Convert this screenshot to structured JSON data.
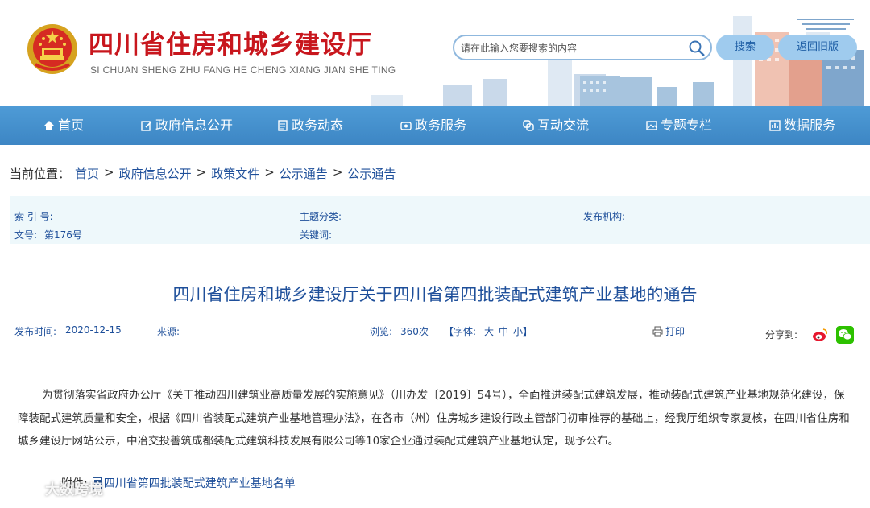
{
  "header": {
    "site_title": "四川省住房和城乡建设厅",
    "site_pinyin": "SI CHUAN SHENG ZHU FANG HE CHENG XIANG JIAN SHE TING",
    "search_placeholder": "请在此输入您要搜索的内容",
    "search_button": "搜索",
    "old_version_button": "返回旧版"
  },
  "nav": {
    "items": [
      {
        "label": "首页",
        "icon": "home-icon"
      },
      {
        "label": "政府信息公开",
        "icon": "edit-icon"
      },
      {
        "label": "政务动态",
        "icon": "document-icon"
      },
      {
        "label": "政务服务",
        "icon": "service-icon"
      },
      {
        "label": "互动交流",
        "icon": "interact-icon"
      },
      {
        "label": "专题专栏",
        "icon": "image-icon"
      },
      {
        "label": "数据服务",
        "icon": "data-icon"
      }
    ]
  },
  "breadcrumb": {
    "prefix": "当前位置：",
    "items": [
      "首页",
      "政府信息公开",
      "政策文件",
      "公示通告",
      "公示通告"
    ],
    "separator": ">"
  },
  "meta": {
    "index_label": "索 引 号:",
    "topic_label": "主题分类:",
    "publisher_label": "发布机构:",
    "doc_no_label": "文号:",
    "doc_no_value": "第176号",
    "keywords_label": "关键词:"
  },
  "article": {
    "title": "四川省住房和城乡建设厅关于四川省第四批装配式建筑产业基地的通告",
    "publish_time_label": "发布时间:",
    "publish_time": "2020-12-15",
    "source_label": "来源:",
    "views_label": "浏览:",
    "views": "360次",
    "font_label": "【字体:",
    "font_large": "大",
    "font_medium": "中",
    "font_small": "小】",
    "print_label": "打印",
    "share_label": "分享到:",
    "body": "为贯彻落实省政府办公厅《关于推动四川建筑业高质量发展的实施意见》（川办发〔2019〕54号），全面推进装配式建筑发展，推动装配式建筑产业基地规范化建设，保障装配式建筑质量和安全，根据《四川省装配式建筑产业基地管理办法》，在各市（州）住房城乡建设行政主管部门初审推荐的基础上，经我厅组织专家复核，在四川省住房和城乡建设厅网站公示，中冶交投善筑成都装配式建筑科技发展有限公司等10家企业通过装配式建筑产业基地认定，现予公布。",
    "attachment_label": "附件:",
    "attachment_name": "四川省第四批装配式建筑产业基地名单"
  },
  "watermark": {
    "text": "大数跨境"
  },
  "colors": {
    "title_red": "#c8161d",
    "nav_blue": "#3d86c4",
    "link_blue": "#1e4f9a",
    "meta_bg": "#eef8fb"
  }
}
